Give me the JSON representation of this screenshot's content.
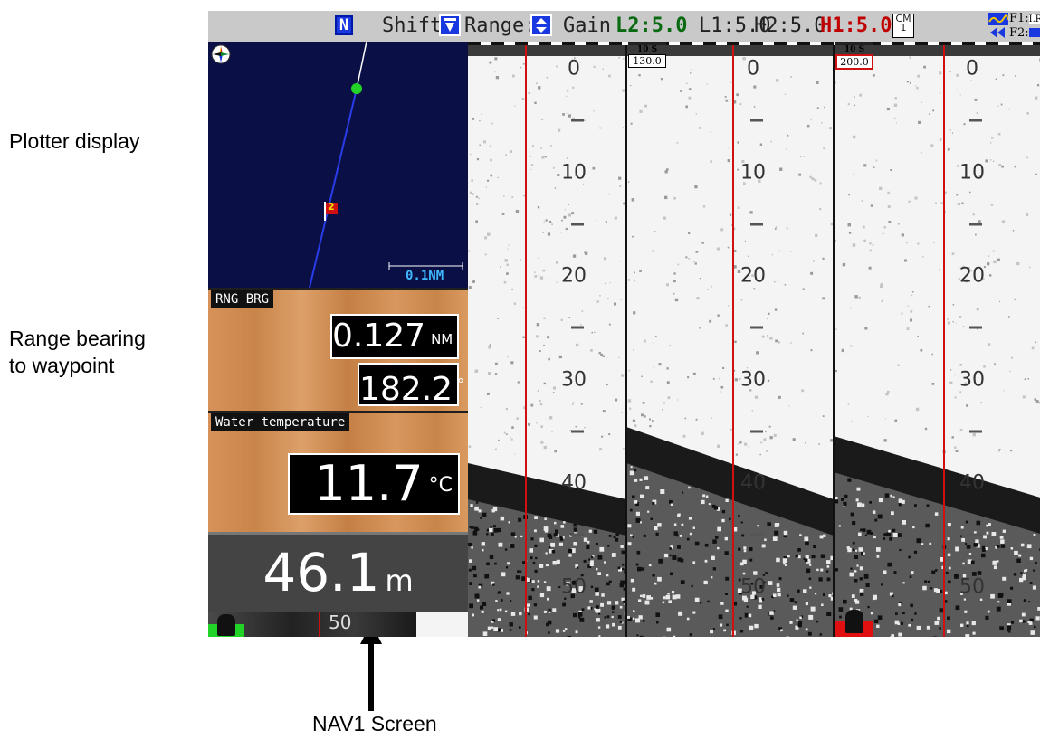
{
  "annotations": {
    "plotter_display": "Plotter display",
    "range_bearing": [
      "Range bearing",
      "to waypoint"
    ],
    "nav1_screen": "NAV1 Screen"
  },
  "topbar": {
    "north_icon": "N",
    "shift_label": "Shift:",
    "range_label": "Range:",
    "gain_label": "Gain",
    "gain_l2": "L2:5.0",
    "gain_l1": "L1:5.0",
    "gain_h2": "H2:5.0",
    "gain_h1": "H1:5.0",
    "cm_icon_top": "CM",
    "cm_icon_bottom": "1",
    "f1_label": "F1:",
    "f1_value": "I.R",
    "f2_label": "F2:",
    "colors": {
      "gain_l2": "#0a6a12",
      "gain_h1": "#c00000"
    }
  },
  "plotter": {
    "scale_label": "0.1NM",
    "waypoint_number": "2",
    "compass_icon": "compass-rose-icon",
    "ship_icon": "ship-position-icon"
  },
  "range_bearing": {
    "label": "RNG BRG",
    "range_value": "0.127",
    "range_unit": "NM",
    "bearing_value": "182.2",
    "bearing_unit": "°"
  },
  "water_temperature": {
    "label": "Water temperature",
    "value": "11.7",
    "unit": "°C"
  },
  "depth_readout": {
    "value": "46.1",
    "unit": "m"
  },
  "nav_strip": {
    "depth_label": "50"
  },
  "echogram": {
    "depth_scale": [
      "0",
      "10",
      "20",
      "30",
      "40",
      "50"
    ],
    "time_tags": [
      {
        "interval": "10 S",
        "value": "130.0"
      },
      {
        "interval": "10 S",
        "value": "200.0"
      }
    ]
  }
}
